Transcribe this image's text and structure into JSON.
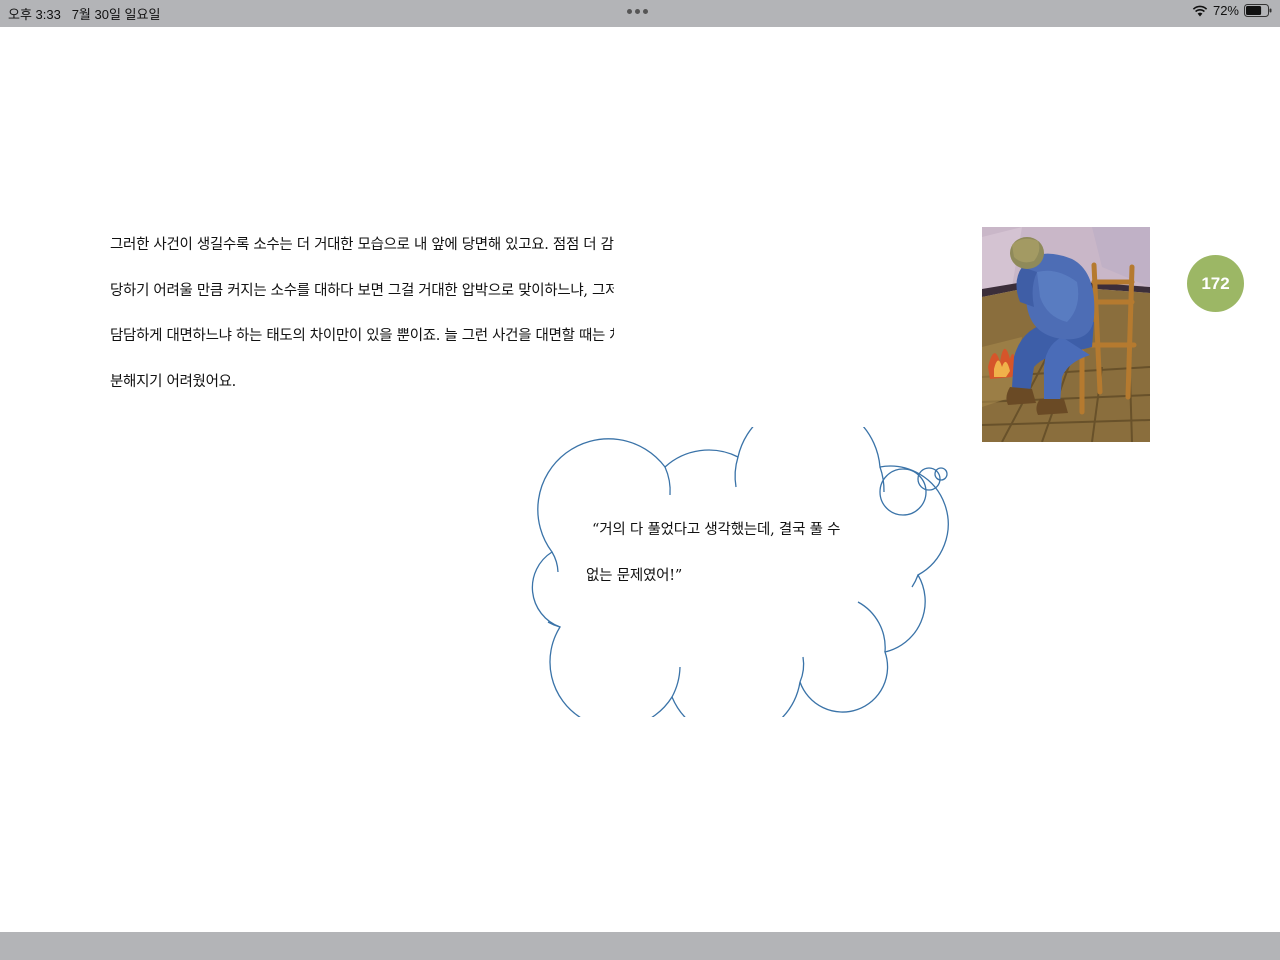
{
  "status_bar": {
    "time": "오후 3:33",
    "date": "7월 30일 일요일",
    "battery_percent": "72%",
    "battery_level": 0.72
  },
  "page": {
    "number": "172",
    "badge_color": "#9cb765",
    "body_lines": [
      "  그러한 사건이 생길수록 소수는 더 거대한 모습으로 내 앞에 당면해 있고요. 점점 더 감",
      "당하기 어려울 만큼 커지는 소수를 대하다 보면 그걸 거대한 압박으로 맞이하느냐, 그저",
      "담담하게 대면하느냐 하는 태도의 차이만이 있을 뿐이죠. 늘 그런 사건을 대면할 때는 차",
      "분해지기 어려웠어요."
    ],
    "thought_bubble": {
      "lines": [
        "“거의 다 풀었다고 생각했는데, 결국 풀 수",
        "없는 문제였어!”"
      ],
      "outline_color": "#3a73a8"
    }
  }
}
